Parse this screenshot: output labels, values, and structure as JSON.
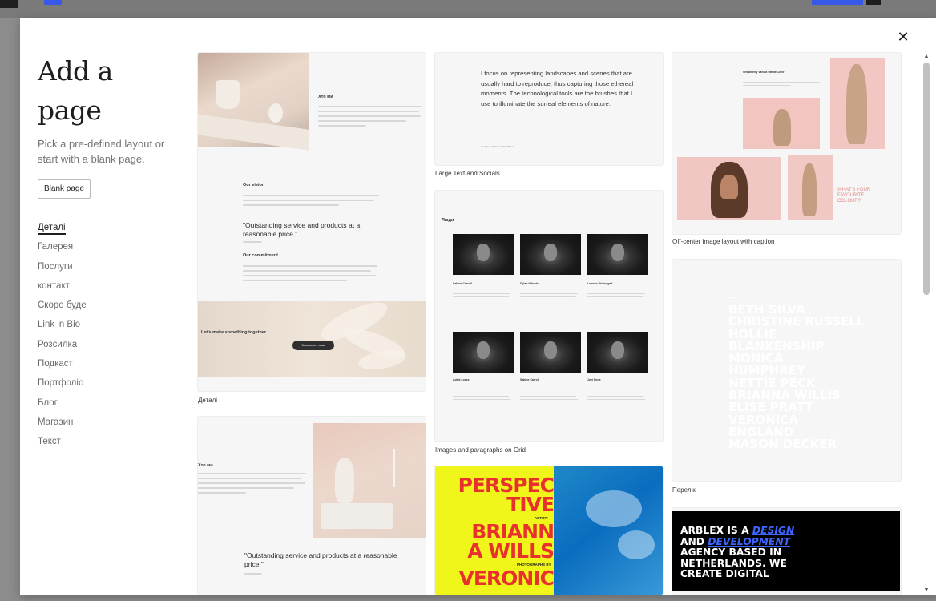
{
  "modal": {
    "title": "Add a page",
    "title_line1": "Add a",
    "title_line2": "page",
    "description": "Pick a pre-defined layout or start with a blank page.",
    "blank_button": "Blank page",
    "close_icon": "close-icon"
  },
  "categories": [
    "Деталі",
    "Галерея",
    "Послуги",
    "контакт",
    "Скоро буде",
    "Link in Bio",
    "Розсилка",
    "Подкаст",
    "Портфоліо",
    "Блог",
    "Магазин",
    "Текст"
  ],
  "layouts": {
    "details": {
      "caption": "Деталі",
      "about_heading": "Хто ми",
      "vision_heading": "Our vision",
      "quote": "\"Outstanding service and products at a reasonable price.\"",
      "commitment_heading": "Our commitment",
      "cta_heading": "Let's make something together",
      "cta_button": "Зв'язатися з нами"
    },
    "large_text": {
      "caption": "Large Text and Socials",
      "text": "I focus on representing landscapes and scenes that are usually hard to reproduce, thus capturing those ethereal moments. The technological tools are the brushes that I use to illuminate the surreal elements of nature.",
      "socials": "Instagram   Behance   WordPress"
    },
    "images_grid": {
      "caption": "Images and paragraphs on Grid",
      "heading": "Люди",
      "people": [
        "Sabine Carroll",
        "Dylan Wheeler",
        "Lennon McDougall",
        "Adele Lopez",
        "Sabine Carroll",
        "Joel Pons"
      ]
    },
    "off_center": {
      "caption": "Off-center image layout with caption",
      "heading": "Strawberry Vanilla Waffle Cone",
      "colour_text": "WHAT'S YOUR FAVOURITE COLOUR?"
    },
    "list": {
      "caption": "Перелік",
      "names": [
        "BETH SILVA",
        "CHRISTINE RUSSELL",
        "HOLLIE",
        "BLANKENSHIP",
        "MONICA",
        "HUMPHREY",
        "NETTIE PECK",
        "BRIANNA WILLIS",
        "ELISE PRATT",
        "VERONICA",
        "ENGLAND",
        "MASON DECKER"
      ]
    },
    "perspective": {
      "line1": "PERSPEC",
      "line2": "TIVE",
      "author_label": "АВТОР:",
      "line3": "BRIANN",
      "line4": "A WILLS",
      "photo_label": "PHOTOGRAPHS BY",
      "line5": "VERONIC"
    },
    "arblex": {
      "text_a": "ARBLEX IS A ",
      "word_design": "DESIGN",
      "text_b": "AND ",
      "word_dev": "DEVELOPMENT",
      "text_c": "AGENCY BASED IN",
      "text_d": "NETHERLANDS. WE",
      "text_e": "CREATE DIGITAL"
    },
    "about_bottom": {
      "heading": "Хто ми",
      "quote": "\"Outstanding service and products at a reasonable price.\""
    }
  },
  "colors": {
    "accent": "#3858e9",
    "red_headline": "#e8312e",
    "yellow": "#f0f51a",
    "link_blue": "#3e66ff"
  }
}
